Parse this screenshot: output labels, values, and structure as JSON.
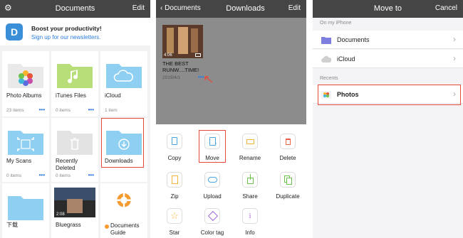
{
  "panel1": {
    "title": "Documents",
    "edit": "Edit",
    "banner": {
      "headline": "Boost your productivity!",
      "link": "Sign up for our newsletters."
    },
    "cells": [
      {
        "name": "Photo Albums",
        "sub": "23 items",
        "dots": "•••"
      },
      {
        "name": "iTunes Files",
        "sub": "0 items",
        "dots": "•••"
      },
      {
        "name": "iCloud",
        "sub": "1 item",
        "dots": ""
      },
      {
        "name": "My Scans",
        "sub": "0 items",
        "dots": "•••"
      },
      {
        "name": "Recently Deleted",
        "sub": "0 items",
        "dots": "•••"
      },
      {
        "name": "Downloads",
        "sub": "",
        "dots": ""
      },
      {
        "name": "下载",
        "sub": "",
        "dots": ""
      },
      {
        "name": "Bluegrass",
        "sub": "",
        "dots": "",
        "duration": "2:08"
      },
      {
        "name": "Documents Guide",
        "sub": "",
        "dots": ""
      }
    ]
  },
  "panel2": {
    "back": "Documents",
    "title": "Downloads",
    "edit": "Edit",
    "file": {
      "name": "THE BEST RUNW....TIME!",
      "date": "2019/4/1",
      "duration": "4:06",
      "dots": "•••"
    },
    "actions": [
      "Copy",
      "Move",
      "Rename",
      "Delete",
      "Zip",
      "Upload",
      "Share",
      "Duplicate",
      "Star",
      "Color tag",
      "Info"
    ]
  },
  "panel3": {
    "title": "Move to",
    "cancel": "Cancel",
    "section1": "On my iPhone",
    "rows": [
      {
        "label": "Documents"
      },
      {
        "label": "iCloud"
      }
    ],
    "section2": "Recents",
    "recent": {
      "label": "Photos"
    }
  },
  "colors": {
    "highlight": "#e34a3a",
    "folder": "#8fd0f2",
    "accent": "#2b7be0"
  }
}
